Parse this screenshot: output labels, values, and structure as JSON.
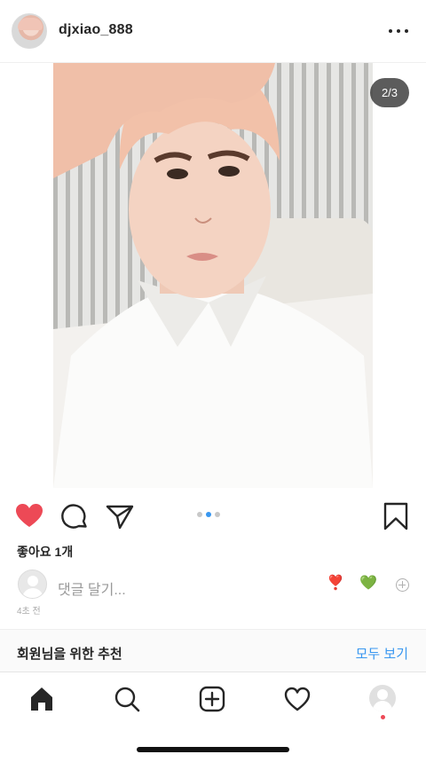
{
  "header": {
    "username": "djxiao_888",
    "avatar_icon": "profile-avatar",
    "more_icon": "more-horizontal-icon"
  },
  "post": {
    "image_counter": "2/3",
    "carousel": {
      "count": 3,
      "active_index": 1
    },
    "liked": true,
    "likes_text": "좋아요 1개"
  },
  "actions": {
    "like_icon": "heart-filled-icon",
    "comment_icon": "comment-icon",
    "share_icon": "paper-plane-icon",
    "save_icon": "bookmark-icon",
    "like_color": "#ed4956"
  },
  "comment_box": {
    "placeholder": "댓글 달기...",
    "quick_emojis": [
      "❣️",
      "💚"
    ],
    "timestamp": "4초 전"
  },
  "recommendations": {
    "title": "회원님을 위한 추천",
    "see_all": "모두 보기",
    "link_color": "#3897f0"
  },
  "tabbar": {
    "items": [
      "home-icon",
      "search-icon",
      "new-post-icon",
      "activity-heart-icon",
      "profile-tab"
    ],
    "active": "home-icon"
  }
}
